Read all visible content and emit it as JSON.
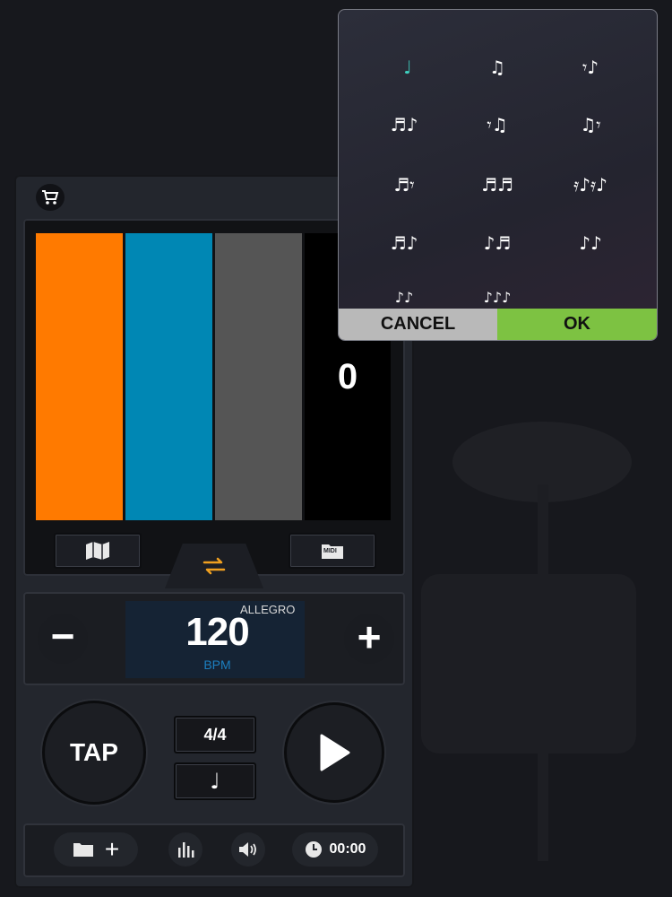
{
  "colors": {
    "beat1": "#ff7a00",
    "beat2": "#0087b4",
    "beat3": "#555555",
    "beat4": "#000000",
    "accent_swap": "#f0a020",
    "ok": "#7dc242",
    "cancel": "#b9b9b9",
    "selected_note": "#3fd1c0"
  },
  "icons": {
    "cart": "cart-icon",
    "map": "map-icon",
    "midi_folder": "midi-folder-icon",
    "swap": "swap-arrows-icon",
    "play": "play-icon",
    "folder": "folder-icon",
    "equalizer": "equalizer-icon",
    "volume": "volume-icon",
    "clock": "clock-icon"
  },
  "beat_display": {
    "count": "0"
  },
  "midi_button": {
    "label": "MIDI"
  },
  "tempo": {
    "value": "120",
    "unit": "BPM",
    "name": "ALLEGRO",
    "minus_label": "−",
    "plus_label": "+"
  },
  "controls": {
    "tap_label": "TAP",
    "time_signature": "4/4",
    "note_value": "♩"
  },
  "bottom_bar": {
    "add_label": "+",
    "timer": "00:00"
  },
  "popup": {
    "notes": [
      {
        "symbol": "♩",
        "selected": true
      },
      {
        "symbol": "♫",
        "selected": false
      },
      {
        "symbol": "𝄾♪",
        "selected": false
      },
      {
        "symbol": "♬♪",
        "selected": false
      },
      {
        "symbol": "𝄾♫",
        "selected": false
      },
      {
        "symbol": "♫𝄾",
        "selected": false
      },
      {
        "symbol": "♬𝄾",
        "selected": false
      },
      {
        "symbol": "♬♬",
        "selected": false
      },
      {
        "symbol": "𝄿♪𝄿♪",
        "selected": false
      },
      {
        "symbol": "♬♪",
        "selected": false
      },
      {
        "symbol": "♪♬",
        "selected": false
      },
      {
        "symbol": "♪♪",
        "selected": false
      },
      {
        "symbol": "♪♪",
        "selected": false
      },
      {
        "symbol": "♪♪♪",
        "selected": false
      }
    ],
    "cancel_label": "CANCEL",
    "ok_label": "OK"
  }
}
